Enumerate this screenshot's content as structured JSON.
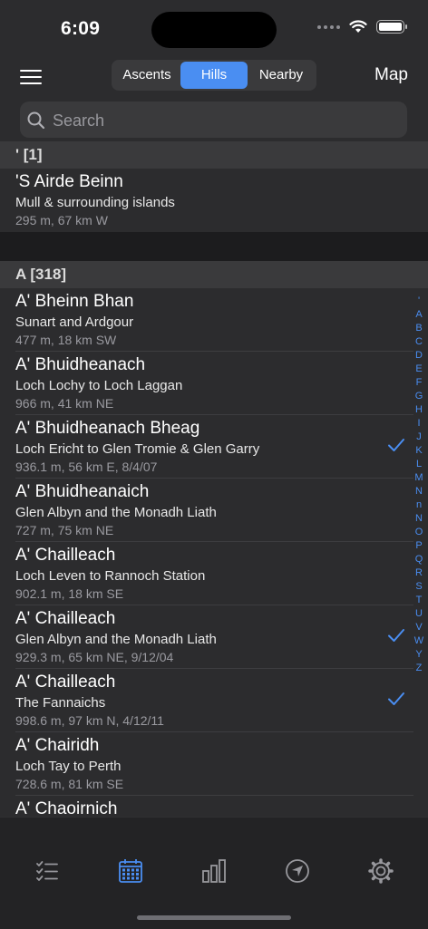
{
  "status_bar": {
    "time": "6:09"
  },
  "nav": {
    "segments": [
      {
        "label": "Ascents",
        "active": false
      },
      {
        "label": "Hills",
        "active": true
      },
      {
        "label": "Nearby",
        "active": false
      }
    ],
    "map_label": "Map"
  },
  "search": {
    "placeholder": "Search"
  },
  "sections": [
    {
      "header": "' [1]",
      "items": [
        {
          "name": "'S Airde Beinn",
          "region": "Mull & surrounding islands",
          "detail": "295 m, 67 km W",
          "checked": false
        }
      ]
    },
    {
      "header": "A [318]",
      "items": [
        {
          "name": "A' Bheinn Bhan",
          "region": "Sunart and Ardgour",
          "detail": "477 m, 18 km SW",
          "checked": false
        },
        {
          "name": "A' Bhuidheanach",
          "region": "Loch Lochy to Loch Laggan",
          "detail": "966 m, 41 km NE",
          "checked": false
        },
        {
          "name": "A' Bhuidheanach Bheag",
          "region": "Loch Ericht to Glen Tromie & Glen Garry",
          "detail": "936.1 m, 56 km E, 8/4/07",
          "checked": true
        },
        {
          "name": "A' Bhuidheanaich",
          "region": "Glen Albyn and the Monadh Liath",
          "detail": "727 m, 75 km NE",
          "checked": false
        },
        {
          "name": "A' Chailleach",
          "region": "Loch Leven to Rannoch Station",
          "detail": "902.1 m, 18 km SE",
          "checked": false
        },
        {
          "name": "A' Chailleach",
          "region": "Glen Albyn and the Monadh Liath",
          "detail": "929.3 m, 65 km NE, 9/12/04",
          "checked": true
        },
        {
          "name": "A' Chailleach",
          "region": "The Fannaichs",
          "detail": "998.6 m, 97 km N, 4/12/11",
          "checked": true
        },
        {
          "name": "A' Chairidh",
          "region": "Loch Tay to Perth",
          "detail": "728.6 m, 81 km SE",
          "checked": false
        },
        {
          "name": "A' Chaoirnich",
          "region": "",
          "detail": "",
          "checked": false
        }
      ]
    }
  ],
  "index_letters": [
    "'",
    "A",
    "B",
    "C",
    "D",
    "E",
    "F",
    "G",
    "H",
    "I",
    "J",
    "K",
    "L",
    "M",
    "N",
    "n",
    "N",
    "O",
    "P",
    "Q",
    "R",
    "S",
    "T",
    "U",
    "V",
    "W",
    "Y",
    "Z"
  ],
  "tab_bar": {
    "tabs": [
      {
        "icon": "checklist-icon",
        "active": false
      },
      {
        "icon": "calendar-icon",
        "active": true
      },
      {
        "icon": "bar-chart-icon",
        "active": false
      },
      {
        "icon": "location-arrow-icon",
        "active": false
      },
      {
        "icon": "gear-icon",
        "active": false
      }
    ]
  },
  "colors": {
    "accent": "#4a8ef2",
    "background": "#1c1c1e",
    "row": "#2c2c2e",
    "section_header": "#3a3a3c"
  }
}
